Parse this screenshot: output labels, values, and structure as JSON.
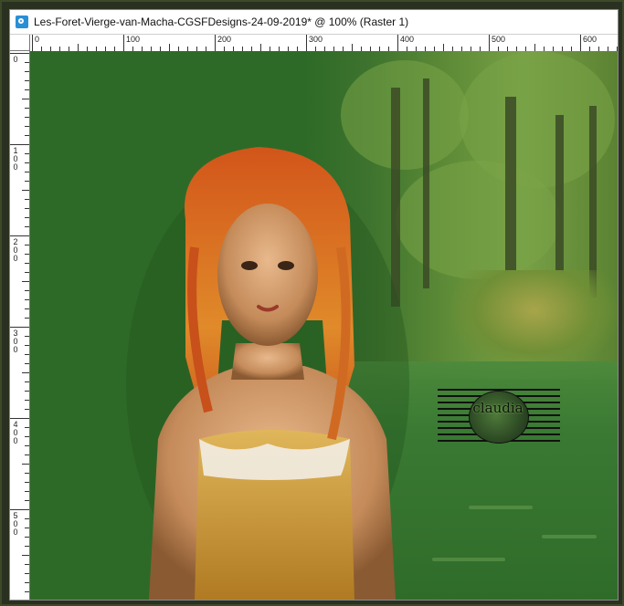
{
  "window": {
    "title": "Les-Foret-Vierge-van-Macha-CGSFDesigns-24-09-2019* @ 100% (Raster 1)"
  },
  "ruler": {
    "horizontal_labels": [
      "0",
      "100",
      "200",
      "300",
      "400",
      "500",
      "600"
    ],
    "vertical_labels": [
      "0",
      "100",
      "200",
      "300",
      "400",
      "500"
    ]
  },
  "canvas": {
    "watermark_text": "claudia",
    "background_color": "#2e6a27",
    "accent_colors": [
      "#7aa447",
      "#c8501a",
      "#d4a84a"
    ]
  }
}
